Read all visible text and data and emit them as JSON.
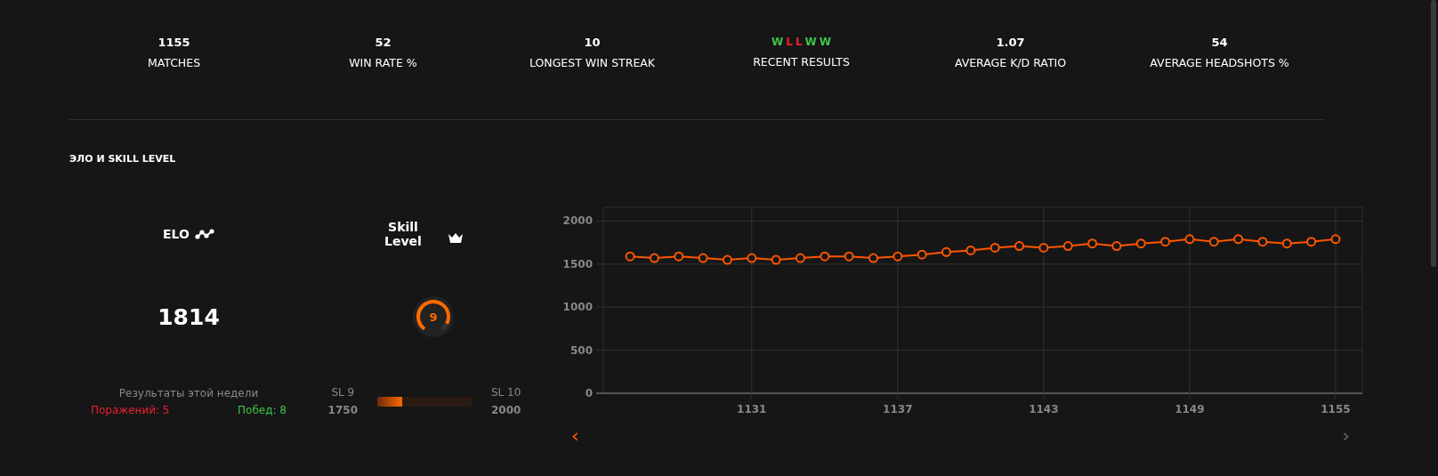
{
  "stats": [
    {
      "value": "1155",
      "label": "MATCHES"
    },
    {
      "value": "52",
      "label": "WIN RATE %"
    },
    {
      "value": "10",
      "label": "LONGEST WIN STREAK"
    },
    {
      "results": [
        {
          "text": "W",
          "color": "#3ec34a"
        },
        {
          "text": "L",
          "color": "#e8212f"
        },
        {
          "text": "L",
          "color": "#e8212f"
        },
        {
          "text": "W",
          "color": "#3ec34a"
        },
        {
          "text": "W",
          "color": "#3ec34a"
        }
      ],
      "label": "RECENT RESULTS"
    },
    {
      "value": "1.07",
      "label": "AVERAGE K/D RATIO"
    },
    {
      "value": "54",
      "label": "AVERAGE HEADSHOTS %"
    }
  ],
  "section_title": "ЭЛО И SKILL LEVEL",
  "elo": {
    "title": "ELO",
    "value": "1814"
  },
  "skill": {
    "title": "Skill Level",
    "level_text": "9",
    "level": 0.9
  },
  "week": {
    "title": "Результаты этой недели",
    "losses": "Поражений: 5",
    "wins": "Побед: 8"
  },
  "progress": {
    "from_label": "SL 9",
    "from_value": "1750",
    "to_label": "SL 10",
    "to_value": "2000",
    "level": 0.26
  },
  "chart_data": {
    "type": "line",
    "x": [
      1126,
      1127,
      1128,
      1129,
      1130,
      1131,
      1132,
      1133,
      1134,
      1135,
      1136,
      1137,
      1138,
      1139,
      1140,
      1141,
      1142,
      1143,
      1144,
      1145,
      1146,
      1147,
      1148,
      1149,
      1150,
      1151,
      1152,
      1153,
      1154,
      1155
    ],
    "series": [
      {
        "color": "#ff5500",
        "marker": "o",
        "values": [
          1590,
          1570,
          1590,
          1570,
          1550,
          1570,
          1550,
          1570,
          1590,
          1590,
          1570,
          1590,
          1610,
          1640,
          1660,
          1690,
          1710,
          1690,
          1710,
          1740,
          1710,
          1740,
          1760,
          1790,
          1760,
          1790,
          1760,
          1740,
          1760,
          1790
        ]
      }
    ],
    "grid": true,
    "xlim": [
      1124.9,
      1156.1
    ],
    "ylim": [
      0,
      2160
    ],
    "xticks": [
      1131,
      1137,
      1143,
      1149,
      1155
    ],
    "yticks": [
      0,
      500,
      1000,
      1500,
      2000
    ]
  },
  "chart_nav": {
    "prev": "‹",
    "next": "›"
  }
}
